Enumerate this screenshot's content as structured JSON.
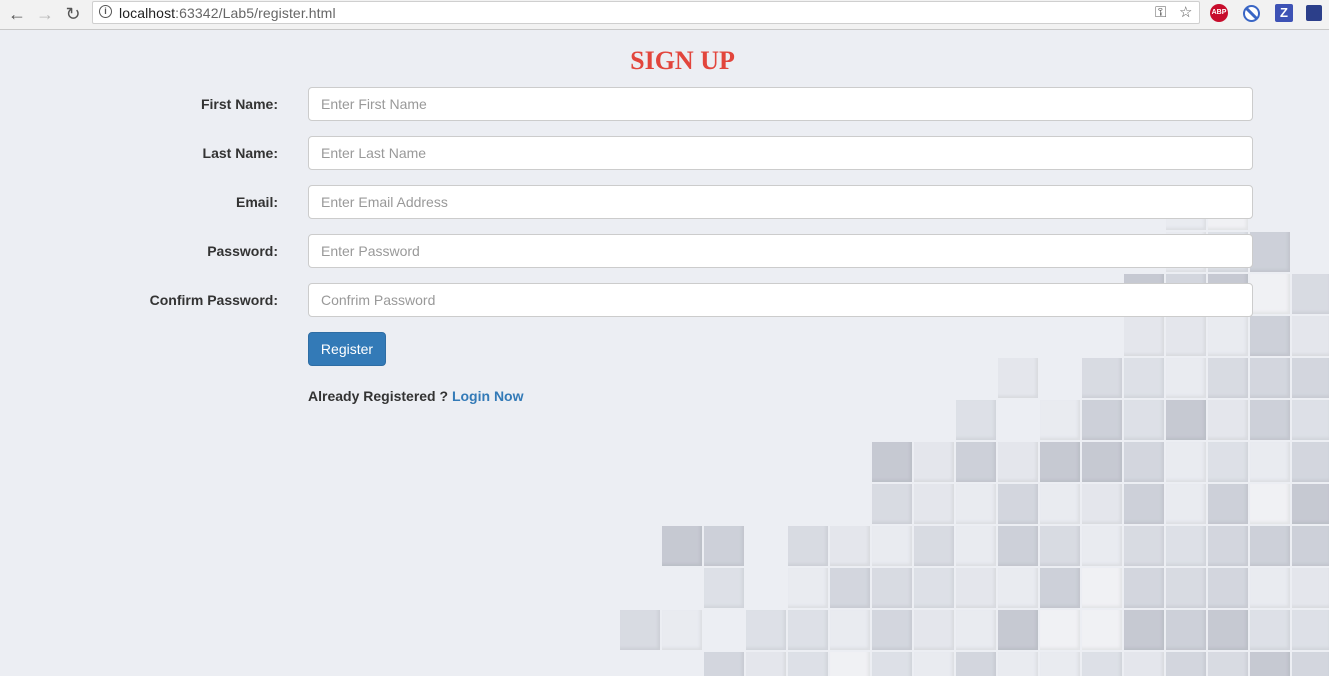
{
  "browser": {
    "url_host": "localhost",
    "url_rest": ":63342/Lab5/register.html",
    "extensions": {
      "abp_label": "ABP",
      "z_label": "Z"
    }
  },
  "page": {
    "title": "SIGN UP",
    "title_color": "#e2453c",
    "accent_color": "#337ab7"
  },
  "form": {
    "fields": [
      {
        "label": "First Name:",
        "placeholder": "Enter First Name"
      },
      {
        "label": "Last Name:",
        "placeholder": "Enter Last Name"
      },
      {
        "label": "Email:",
        "placeholder": "Enter Email Address"
      },
      {
        "label": "Password:",
        "placeholder": "Enter Password"
      },
      {
        "label": "Confirm Password:",
        "placeholder": "Confrim Password"
      }
    ],
    "register_label": "Register",
    "already_text": "Already Registered ?",
    "login_label": "Login Now"
  }
}
